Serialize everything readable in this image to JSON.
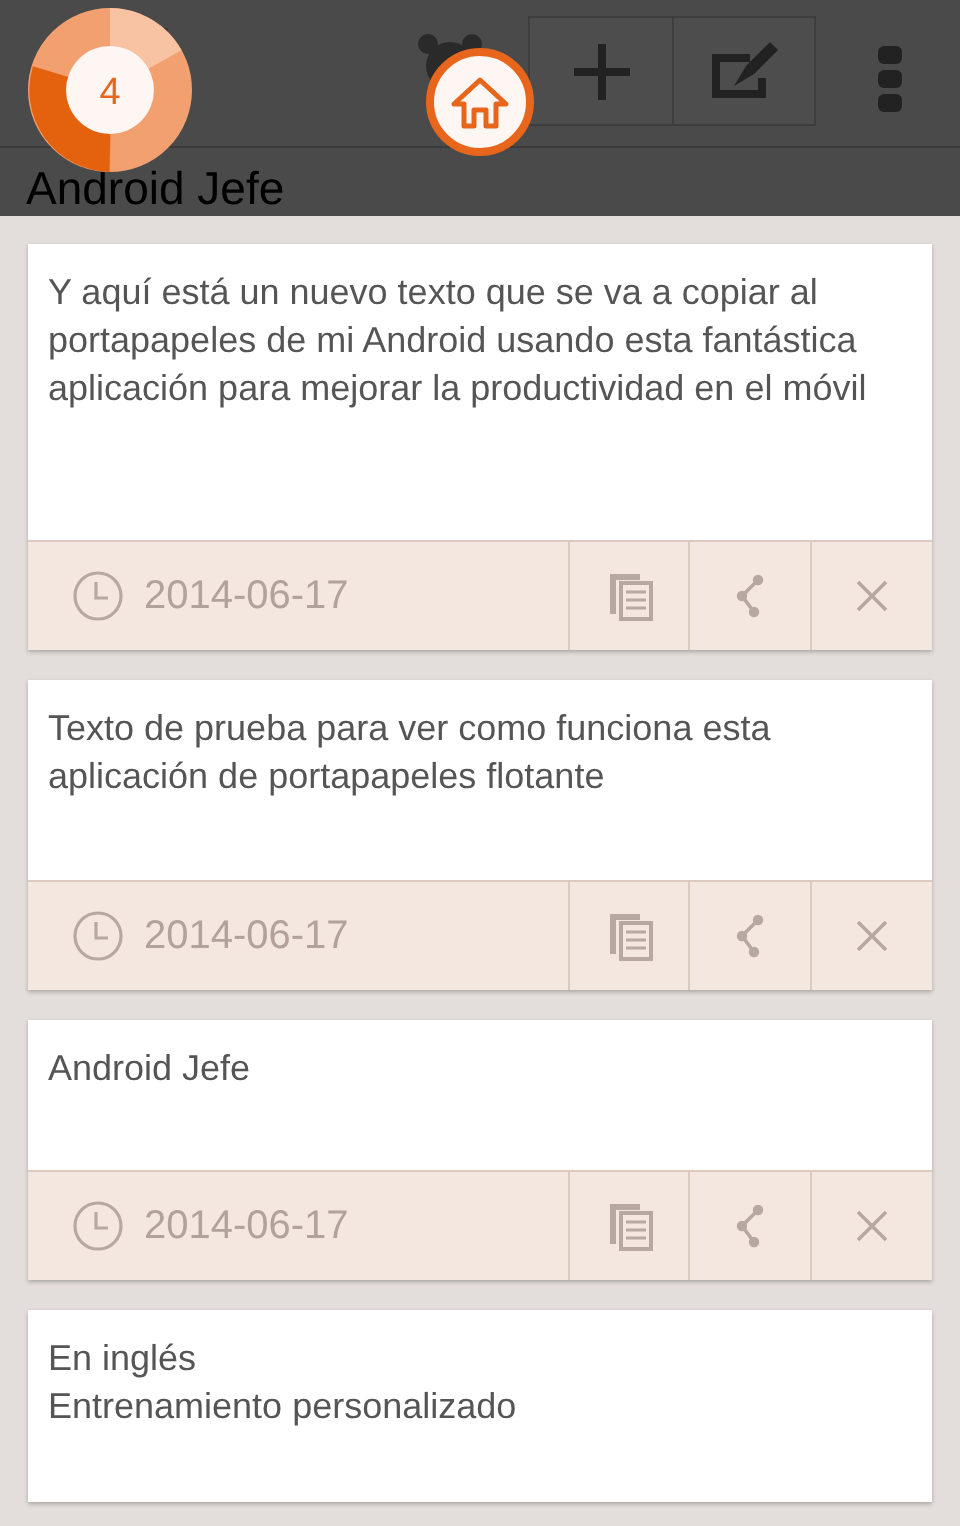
{
  "badge": {
    "count": "4"
  },
  "title": "Android Jefe",
  "clips": [
    {
      "text": "Y aquí está un nuevo texto que se va a copiar al portapapeles de mi Android usando esta fantástica aplicación para mejorar la productividad en el móvil",
      "date": "2014-06-17"
    },
    {
      "text": "Texto de prueba para ver como funciona esta aplicación de portapapeles flotante",
      "date": "2014-06-17"
    },
    {
      "text": "Android Jefe",
      "date": "2014-06-17"
    },
    {
      "text": "En inglés\nEntrenamiento personalizado"
    }
  ]
}
